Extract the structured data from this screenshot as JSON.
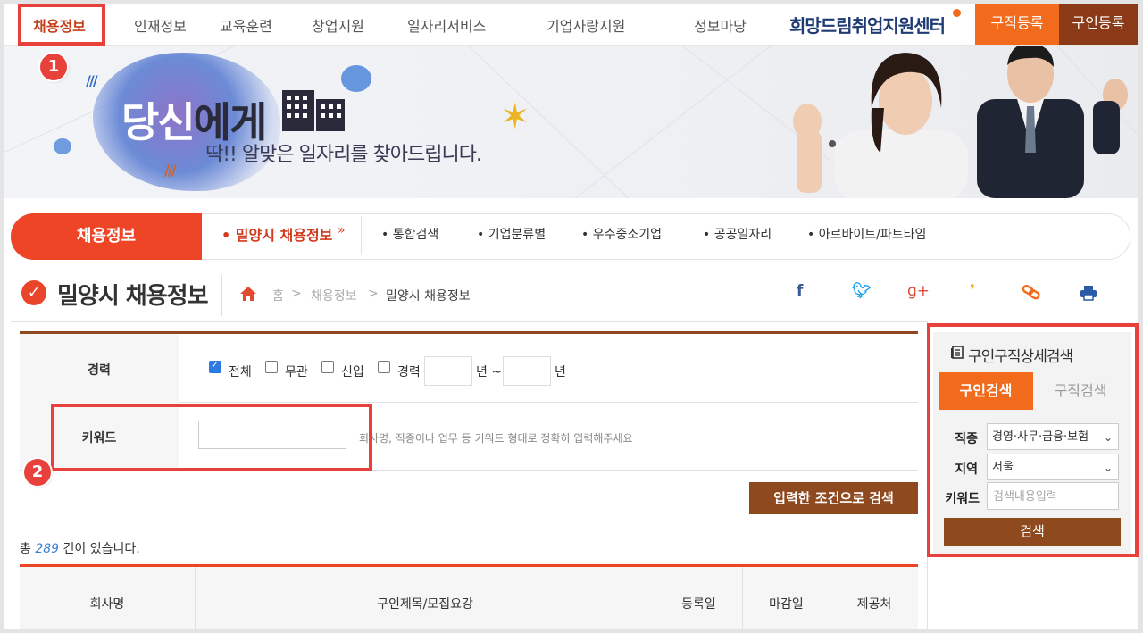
{
  "topnav": {
    "items": [
      "채용정보",
      "인재정보",
      "교육훈련",
      "창업지원",
      "일자리서비스",
      "기업사랑지원",
      "정보마당"
    ],
    "brand": "희망드림취업지원센터",
    "seek_btn": "구직등록",
    "hire_btn": "구인등록"
  },
  "banner": {
    "headline_1": "당신",
    "headline_2": "에게",
    "subtitle": "딱!! 알맞은 일자리를 찾아드립니다."
  },
  "subnav": {
    "section": "채용정보",
    "active": "• 밀양시 채용정보",
    "items": [
      "• 통합검색",
      "• 기업분류별",
      "• 우수중소기업",
      "• 공공일자리",
      "• 아르바이트/파트타임"
    ]
  },
  "page": {
    "title": "밀양시 채용정보",
    "breadcrumb": [
      "홈",
      "채용정보",
      "밀양시 채용정보"
    ]
  },
  "share_icons": [
    "facebook-icon",
    "twitter-icon",
    "google-plus-icon",
    "kakao-story-icon",
    "link-icon",
    "print-icon"
  ],
  "form": {
    "career_label": "경력",
    "career_options": [
      {
        "label": "전체",
        "checked": true
      },
      {
        "label": "무관",
        "checked": false
      },
      {
        "label": "신입",
        "checked": false
      },
      {
        "label": "경력",
        "checked": false
      }
    ],
    "year_from_suffix": "년 ~",
    "year_to_suffix": "년",
    "keyword_label": "키워드",
    "keyword_value": "",
    "keyword_hint": "회사명, 직종이나 업무 등 키워드 형태로 정확히 입력해주세요",
    "submit": "입력한 조건으로 검색"
  },
  "result": {
    "prefix": "총",
    "count": "289",
    "suffix": "건이 있습니다."
  },
  "table": {
    "columns": [
      "회사명",
      "구인제목/모집요강",
      "등록일",
      "마감일",
      "제공처"
    ]
  },
  "side": {
    "title": "구인구직상세검색",
    "tab_active": "구인검색",
    "tab_inactive": "구직검색",
    "job_label": "직종",
    "job_value": "경영·사무·금융·보험",
    "region_label": "지역",
    "region_value": "서울",
    "keyword_label": "키워드",
    "keyword_placeholder": "검색내용입력",
    "search_btn": "검색"
  },
  "annotations": [
    "1",
    "2"
  ],
  "colors": {
    "accent_red": "#ee4526",
    "accent_orange": "#f26a1b",
    "brown": "#8e4a1e",
    "highlight": "#e8403b"
  }
}
